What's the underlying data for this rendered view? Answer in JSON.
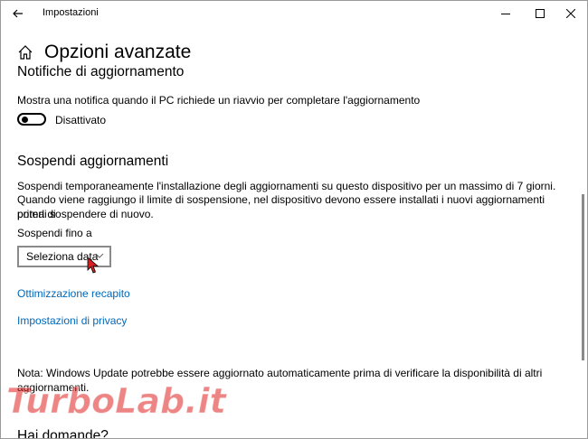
{
  "window": {
    "title": "Impostazioni"
  },
  "page": {
    "title": "Opzioni avanzate"
  },
  "notifications": {
    "heading": "Notifiche di aggiornamento",
    "description": "Mostra una notifica quando il PC richiede un riavvio per completare l'aggiornamento",
    "toggle_state": "Disattivato"
  },
  "pause": {
    "heading": "Sospendi aggiornamenti",
    "line1": "Sospendi temporaneamente l'installazione degli aggiornamenti su questo dispositivo per un massimo di 7 giorni.",
    "line2": "Quando viene raggiungo il limite di sospensione, nel dispositivo devono essere installati i nuovi aggiornamenti prima di",
    "line3": "poterli sospendere di nuovo.",
    "until_label": "Sospendi fino a",
    "dropdown_value": "Seleziona data"
  },
  "links": {
    "delivery": "Ottimizzazione recapito",
    "privacy": "Impostazioni di privacy"
  },
  "note": {
    "line1": "Nota: Windows Update potrebbe essere aggiornato automaticamente prima di verificare la disponibilità di altri",
    "line2": "aggiornamenti."
  },
  "questions": {
    "heading": "Hai domande?"
  },
  "watermark": {
    "text": "TurboLab.it"
  },
  "colors": {
    "link": "#0067b8",
    "watermark": "#e02020"
  }
}
